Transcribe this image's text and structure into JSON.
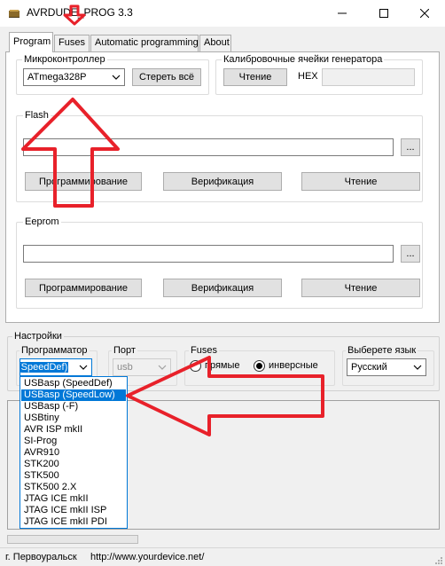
{
  "window": {
    "title": "AVRDUDE_PROG 3.3",
    "min_icon": "minimize-icon",
    "max_icon": "maximize-icon",
    "close_icon": "close-icon"
  },
  "tabs": [
    {
      "label": "Program"
    },
    {
      "label": "Fuses"
    },
    {
      "label": "Automatic programming"
    },
    {
      "label": "About"
    }
  ],
  "mcu": {
    "group_label": "Микроконтроллер",
    "selected": "ATmega328P",
    "erase_label": "Стереть всё"
  },
  "calib": {
    "group_label": "Калибровочные ячейки генератора",
    "read_label": "Чтение",
    "hex_label": "HEX",
    "hex_value": ""
  },
  "flash": {
    "group_label": "Flash",
    "path": "",
    "browse_label": "...",
    "program_label": "Программирование",
    "verify_label": "Верификация",
    "read_label": "Чтение"
  },
  "eeprom": {
    "group_label": "Eeprom",
    "path": "",
    "browse_label": "...",
    "program_label": "Программирование",
    "verify_label": "Верификация",
    "read_label": "Чтение"
  },
  "settings": {
    "group_label": "Настройки",
    "programmer_label": "Программатор",
    "programmer_value": "(SpeedDef)",
    "port_label": "Порт",
    "port_value": "usb",
    "fuses_label": "Fuses",
    "fuses_direct_label": "прямые",
    "fuses_inverse_label": "инверсные",
    "fuses_selected": "инверсные",
    "language_label": "Выберете язык",
    "language_value": "Русский"
  },
  "programmer_options": [
    "USBasp (SpeedDef)",
    "USBasp (SpeedLow)",
    "USBasp (-F)",
    "USBtiny",
    "AVR ISP mkII",
    "SI-Prog",
    "AVR910",
    "STK200",
    "STK500",
    "STK500 2.X",
    "JTAG ICE mkII",
    "JTAG ICE mkII ISP",
    "JTAG ICE mkII PDI"
  ],
  "programmer_highlighted": "USBasp (SpeedLow)",
  "status": {
    "city": "г. Первоуральск",
    "url": "http://www.yourdevice.net/"
  },
  "colors": {
    "annotation_arrow": "#e8212a",
    "selection": "#0078d7",
    "window_bg": "#f0f0f0"
  }
}
